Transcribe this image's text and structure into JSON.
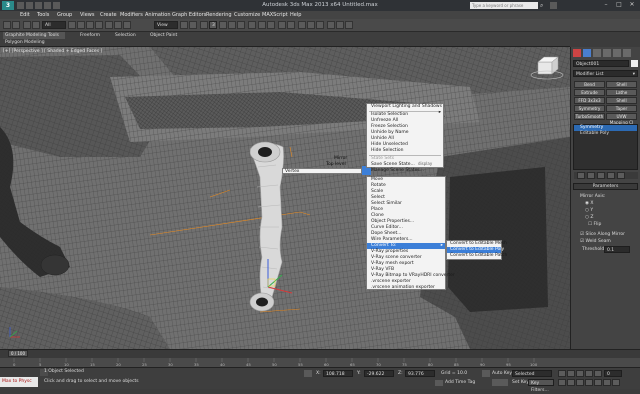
{
  "window": {
    "app_icon_label": "3",
    "title": "Autodesk 3ds Max 2013 x64    Untitled.max",
    "search_placeholder": "Type a keyword or phrase",
    "controls": [
      "–",
      "□",
      "✕"
    ]
  },
  "menubar": [
    "Edit",
    "Tools",
    "Group",
    "Views",
    "Create",
    "Modifiers",
    "Animation",
    "Graph Editors",
    "Rendering",
    "Customize",
    "MAXScript",
    "Help"
  ],
  "toolbar": {
    "selection_filter": "All",
    "view_dropdown": "View",
    "snap_value": "3"
  },
  "ribbon": {
    "tabs": [
      "Graphite Modeling Tools",
      "Freeform",
      "Selection",
      "Object Paint"
    ],
    "active_panel": "Polygon Modeling"
  },
  "viewport": {
    "label": "[+] [Perspective ] [ Shaded + Edged Faces ]",
    "accent_color": "#e98a1e"
  },
  "quad_menu": {
    "left_labels": [
      "Mirror",
      "Top level",
      "Vertex"
    ],
    "top_right": [
      {
        "label": "Viewport Lighting and Shadows",
        "submenu": true
      },
      {
        "sep": true
      },
      {
        "label": "Isolate Selection"
      },
      {
        "label": "Unfreeze All"
      },
      {
        "label": "Freeze Selection"
      },
      {
        "label": "Unhide by Name"
      },
      {
        "label": "Unhide All"
      },
      {
        "label": "Hide Unselected"
      },
      {
        "label": "Hide Selection"
      },
      {
        "sep": true
      },
      {
        "label": "State Sets",
        "disabled": true
      },
      {
        "label": "Save Scene State..."
      },
      {
        "label": "Manage Scene States..."
      }
    ],
    "quad_titles": {
      "display": "display",
      "transform": "transform"
    },
    "bottom_right": [
      {
        "label": "Move"
      },
      {
        "label": "Rotate"
      },
      {
        "label": "Scale"
      },
      {
        "label": "Select"
      },
      {
        "label": "Select Similar"
      },
      {
        "label": "Place"
      },
      {
        "label": "Clone"
      },
      {
        "label": "Object Properties..."
      },
      {
        "label": "Curve Editor..."
      },
      {
        "label": "Dope Sheet..."
      },
      {
        "label": "Wire Parameters..."
      },
      {
        "label": "Convert To:",
        "highlight": true,
        "submenu": true
      },
      {
        "label": "V-Ray properties"
      },
      {
        "label": "V-Ray scene converter"
      },
      {
        "label": "V-Ray mesh export"
      },
      {
        "label": "V-Ray VFB"
      },
      {
        "label": "V-Ray Bitmap to VRayHDRI converter"
      },
      {
        "label": ".vrscene exporter"
      },
      {
        "label": ".vrscene animation exporter"
      }
    ],
    "convert_submenu": [
      {
        "label": "Convert to Editable Mesh"
      },
      {
        "label": "Convert to Editable Poly",
        "highlight": true
      },
      {
        "label": "Convert to Editable Patch"
      }
    ]
  },
  "command_panel": {
    "object_name": "Object001",
    "modifier_list": "Modifier List",
    "buttons": [
      [
        "Bend",
        "Shell"
      ],
      [
        "Extrude",
        "Lathe"
      ],
      [
        "FFD 3x3x3",
        "Shell"
      ],
      [
        "Symmetry",
        "Taper"
      ],
      [
        "TurboSmooth",
        "UVW Mapping Cl"
      ]
    ],
    "stack": [
      {
        "label": "Symmetry",
        "selected": true
      },
      {
        "label": "Editable Poly",
        "selected": false
      }
    ],
    "parameters_title": "Parameters",
    "mirror_axis_label": "Mirror Axis:",
    "axes": [
      "X",
      "Y",
      "Z"
    ],
    "selected_axis": "X",
    "flip_label": "Flip",
    "slice_label": "Slice Along Mirror",
    "weld_label": "Weld Seam",
    "threshold_label": "Threshold:",
    "threshold_value": "0.1"
  },
  "timeline": {
    "frame_display": "0 / 100",
    "ticks": [
      "0",
      "5",
      "10",
      "15",
      "20",
      "25",
      "30",
      "35",
      "40",
      "45",
      "50",
      "55",
      "60",
      "65",
      "70",
      "75",
      "80",
      "85",
      "90",
      "95",
      "100"
    ]
  },
  "status": {
    "maxscript_text": "Max to Physc",
    "objects_selected": "1 Object Selected",
    "prompt": "Click and drag to select and move objects",
    "x_label": "X:",
    "x_value": "108.718",
    "y_label": "Y:",
    "y_value": "-29.622",
    "z_label": "Z:",
    "z_value": "93.776",
    "grid_label": "Grid = 10.0",
    "add_time_tag": "Add Time Tag",
    "auto_key": "Auto Key",
    "selected_dropdown": "Selected",
    "set_key": "Set Key",
    "key_filters": "Key Filters...",
    "frame_value": "0"
  }
}
